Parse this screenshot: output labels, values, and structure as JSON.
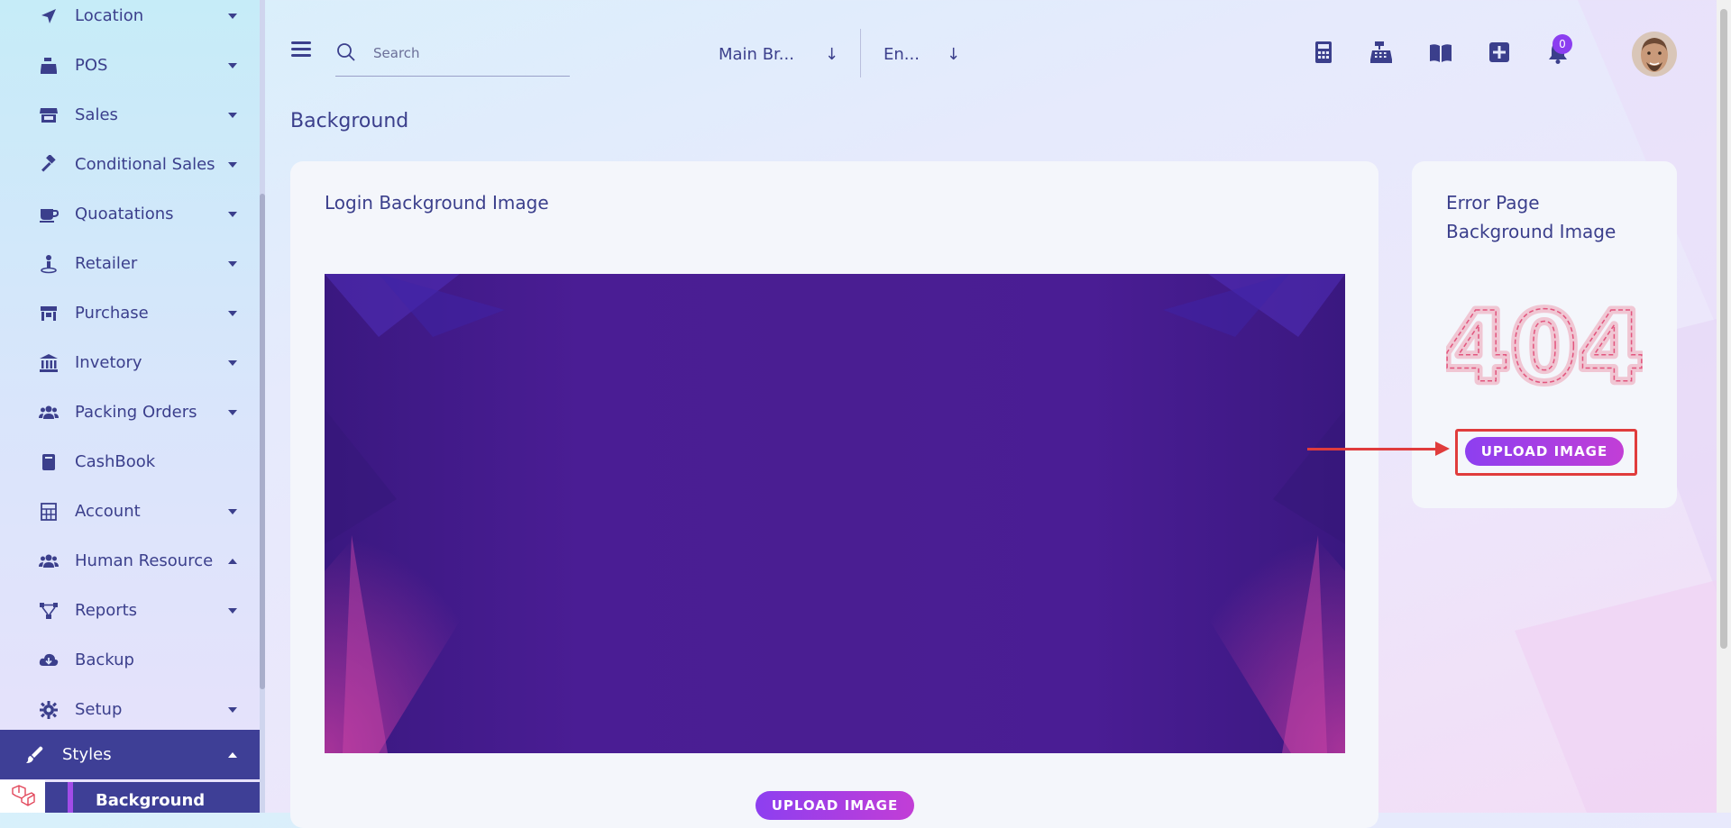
{
  "sidebar": {
    "items": [
      {
        "label": "Location",
        "icon": "location-arrow-icon",
        "caret": "down"
      },
      {
        "label": "POS",
        "icon": "cash-register-icon",
        "caret": "down"
      },
      {
        "label": "Sales",
        "icon": "store-icon",
        "caret": "down"
      },
      {
        "label": "Conditional Sales",
        "icon": "gavel-icon",
        "caret": "down"
      },
      {
        "label": "Quoatations",
        "icon": "coffee-cup-icon",
        "caret": "down"
      },
      {
        "label": "Retailer",
        "icon": "person-icon",
        "caret": "down"
      },
      {
        "label": "Purchase",
        "icon": "shop-icon",
        "caret": "down"
      },
      {
        "label": "Invetory",
        "icon": "bank-icon",
        "caret": "down"
      },
      {
        "label": "Packing Orders",
        "icon": "users-icon",
        "caret": "down"
      },
      {
        "label": "CashBook",
        "icon": "book-icon",
        "caret": ""
      },
      {
        "label": "Account",
        "icon": "calculator-icon",
        "caret": "down"
      },
      {
        "label": "Human Resource",
        "icon": "users-icon",
        "caret": "up"
      },
      {
        "label": "Reports",
        "icon": "project-diagram-icon",
        "caret": "down"
      },
      {
        "label": "Backup",
        "icon": "cloud-download-icon",
        "caret": ""
      },
      {
        "label": "Setup",
        "icon": "gear-icon",
        "caret": "down"
      }
    ],
    "active": {
      "label": "Styles",
      "icon": "paint-brush-icon"
    },
    "sub_active": {
      "label": "Background"
    }
  },
  "header": {
    "search": {
      "placeholder": "Search"
    },
    "branch": {
      "value": "Main Br..."
    },
    "language": {
      "value": "En..."
    },
    "notification_count": "0"
  },
  "main": {
    "page_title": "Background",
    "login_card": {
      "title": "Login Background Image",
      "button": "UPLOAD IMAGE"
    },
    "error_card": {
      "title_line1": "Error Page",
      "title_line2": "Background Image",
      "button": "UPLOAD IMAGE",
      "image_text": "404"
    }
  },
  "colors": {
    "accent": "#8d3ff0",
    "sidebar_active": "#3e3f96",
    "text": "#3b3f8c",
    "annotation": "#e03c3c"
  }
}
